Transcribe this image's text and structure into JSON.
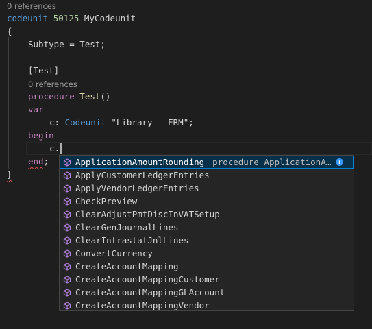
{
  "codelens": {
    "top": "0 references",
    "procedure": "0 references"
  },
  "code": {
    "kw_codeunit": "codeunit",
    "codeunit_id": "50125",
    "codeunit_name": "MyCodeunit",
    "open_brace": "{",
    "subtype_line": "Subtype = Test;",
    "attribute": "[Test]",
    "kw_procedure": "procedure",
    "proc_name": "Test",
    "proc_parens": "()",
    "kw_var": "var",
    "var_name": "c:",
    "var_type": "Codeunit",
    "var_target": "\"Library - ERM\"",
    "var_semicolon": ";",
    "kw_begin": "begin",
    "typed_text": "c.",
    "kw_end": "end",
    "end_semicolon": ";",
    "close_brace": "}"
  },
  "suggestions": {
    "items": [
      {
        "label": "ApplicationAmountRounding",
        "detail": "procedure ApplicationA…",
        "selected": true,
        "icon": "method-cube-icon"
      },
      {
        "label": "ApplyCustomerLedgerEntries",
        "icon": "method-cube-icon"
      },
      {
        "label": "ApplyVendorLedgerEntries",
        "icon": "method-cube-icon"
      },
      {
        "label": "CheckPreview",
        "icon": "method-cube-icon"
      },
      {
        "label": "ClearAdjustPmtDiscInVATSetup",
        "icon": "method-cube-icon"
      },
      {
        "label": "ClearGenJournalLines",
        "icon": "method-cube-icon"
      },
      {
        "label": "ClearIntrastatJnlLines",
        "icon": "method-cube-icon"
      },
      {
        "label": "ConvertCurrency",
        "icon": "method-cube-icon"
      },
      {
        "label": "CreateAccountMapping",
        "icon": "method-cube-icon"
      },
      {
        "label": "CreateAccountMappingCustomer",
        "icon": "method-cube-icon"
      },
      {
        "label": "CreateAccountMappingGLAccount",
        "icon": "method-cube-icon"
      },
      {
        "label": "CreateAccountMappingVendor",
        "icon": "method-cube-icon"
      }
    ],
    "info_glyph": "i"
  },
  "colors": {
    "background": "#1e1e1e",
    "keyword": "#c586c0",
    "control_keyword": "#569cd6",
    "type": "#4ec9b0",
    "number": "#b5cea8",
    "string": "#ce9178",
    "function": "#dcdcaa",
    "selection": "#062f4a",
    "icon_purple": "#b180d7"
  }
}
